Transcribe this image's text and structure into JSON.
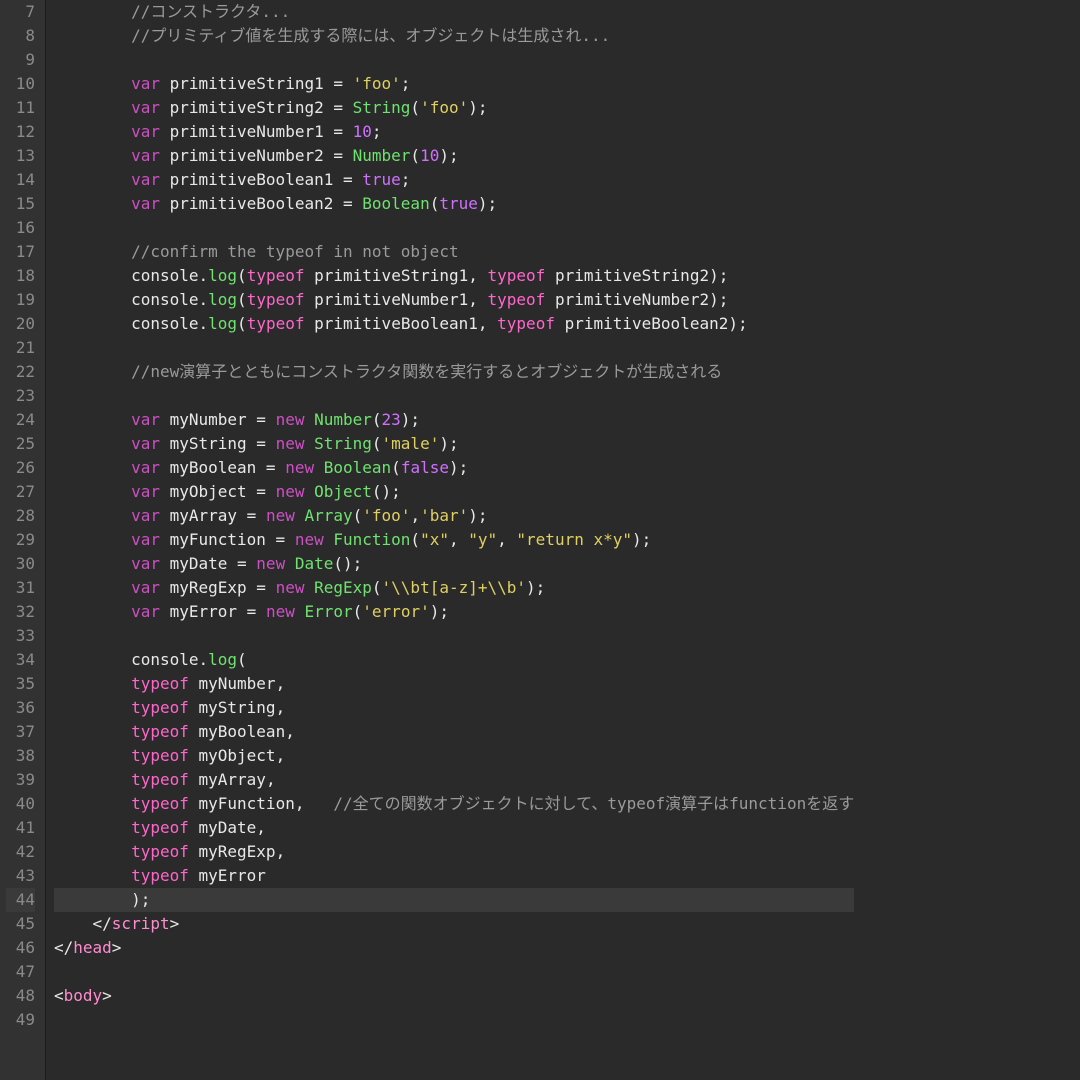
{
  "editor": {
    "first_line_number": 7,
    "current_line_number": 44,
    "lines": [
      {
        "tokens": [
          {
            "c": "c-com",
            "t": "        //コンストラクタ..."
          }
        ]
      },
      {
        "tokens": [
          {
            "c": "c-com",
            "t": "        //プリミティブ値を生成する際には、オブジェクトは生成され..."
          }
        ]
      },
      {
        "tokens": []
      },
      {
        "tokens": [
          {
            "c": "c-kw",
            "t": "        var "
          },
          {
            "c": "c-id",
            "t": "primitiveString1"
          },
          {
            "c": "c-pun",
            "t": " = "
          },
          {
            "c": "c-str",
            "t": "'foo'"
          },
          {
            "c": "c-pun",
            "t": ";"
          }
        ]
      },
      {
        "tokens": [
          {
            "c": "c-kw",
            "t": "        var "
          },
          {
            "c": "c-id",
            "t": "primitiveString2"
          },
          {
            "c": "c-pun",
            "t": " = "
          },
          {
            "c": "c-func",
            "t": "String"
          },
          {
            "c": "c-pun",
            "t": "("
          },
          {
            "c": "c-str",
            "t": "'foo'"
          },
          {
            "c": "c-pun",
            "t": ");"
          }
        ]
      },
      {
        "tokens": [
          {
            "c": "c-kw",
            "t": "        var "
          },
          {
            "c": "c-id",
            "t": "primitiveNumber1"
          },
          {
            "c": "c-pun",
            "t": " = "
          },
          {
            "c": "c-num",
            "t": "10"
          },
          {
            "c": "c-pun",
            "t": ";"
          }
        ]
      },
      {
        "tokens": [
          {
            "c": "c-kw",
            "t": "        var "
          },
          {
            "c": "c-id",
            "t": "primitiveNumber2"
          },
          {
            "c": "c-pun",
            "t": " = "
          },
          {
            "c": "c-func",
            "t": "Number"
          },
          {
            "c": "c-pun",
            "t": "("
          },
          {
            "c": "c-num",
            "t": "10"
          },
          {
            "c": "c-pun",
            "t": ");"
          }
        ]
      },
      {
        "tokens": [
          {
            "c": "c-kw",
            "t": "        var "
          },
          {
            "c": "c-id",
            "t": "primitiveBoolean1"
          },
          {
            "c": "c-pun",
            "t": " = "
          },
          {
            "c": "c-bool",
            "t": "true"
          },
          {
            "c": "c-pun",
            "t": ";"
          }
        ]
      },
      {
        "tokens": [
          {
            "c": "c-kw",
            "t": "        var "
          },
          {
            "c": "c-id",
            "t": "primitiveBoolean2"
          },
          {
            "c": "c-pun",
            "t": " = "
          },
          {
            "c": "c-func",
            "t": "Boolean"
          },
          {
            "c": "c-pun",
            "t": "("
          },
          {
            "c": "c-bool",
            "t": "true"
          },
          {
            "c": "c-pun",
            "t": ");"
          }
        ]
      },
      {
        "tokens": []
      },
      {
        "tokens": [
          {
            "c": "c-com",
            "t": "        //confirm the typeof in not object"
          }
        ]
      },
      {
        "tokens": [
          {
            "c": "c-id",
            "t": "        console"
          },
          {
            "c": "c-pun",
            "t": "."
          },
          {
            "c": "c-func",
            "t": "log"
          },
          {
            "c": "c-pun",
            "t": "("
          },
          {
            "c": "c-op",
            "t": "typeof "
          },
          {
            "c": "c-id",
            "t": "primitiveString1"
          },
          {
            "c": "c-pun",
            "t": ", "
          },
          {
            "c": "c-op",
            "t": "typeof "
          },
          {
            "c": "c-id",
            "t": "primitiveString2"
          },
          {
            "c": "c-pun",
            "t": ");"
          }
        ]
      },
      {
        "tokens": [
          {
            "c": "c-id",
            "t": "        console"
          },
          {
            "c": "c-pun",
            "t": "."
          },
          {
            "c": "c-func",
            "t": "log"
          },
          {
            "c": "c-pun",
            "t": "("
          },
          {
            "c": "c-op",
            "t": "typeof "
          },
          {
            "c": "c-id",
            "t": "primitiveNumber1"
          },
          {
            "c": "c-pun",
            "t": ", "
          },
          {
            "c": "c-op",
            "t": "typeof "
          },
          {
            "c": "c-id",
            "t": "primitiveNumber2"
          },
          {
            "c": "c-pun",
            "t": ");"
          }
        ]
      },
      {
        "tokens": [
          {
            "c": "c-id",
            "t": "        console"
          },
          {
            "c": "c-pun",
            "t": "."
          },
          {
            "c": "c-func",
            "t": "log"
          },
          {
            "c": "c-pun",
            "t": "("
          },
          {
            "c": "c-op",
            "t": "typeof "
          },
          {
            "c": "c-id",
            "t": "primitiveBoolean1"
          },
          {
            "c": "c-pun",
            "t": ", "
          },
          {
            "c": "c-op",
            "t": "typeof "
          },
          {
            "c": "c-id",
            "t": "primitiveBoolean2"
          },
          {
            "c": "c-pun",
            "t": ");"
          }
        ]
      },
      {
        "tokens": []
      },
      {
        "tokens": [
          {
            "c": "c-com",
            "t": "        //new演算子とともにコンストラクタ関数を実行するとオブジェクトが生成される"
          }
        ]
      },
      {
        "tokens": []
      },
      {
        "tokens": [
          {
            "c": "c-kw",
            "t": "        var "
          },
          {
            "c": "c-id",
            "t": "myNumber"
          },
          {
            "c": "c-pun",
            "t": " = "
          },
          {
            "c": "c-kw",
            "t": "new "
          },
          {
            "c": "c-func",
            "t": "Number"
          },
          {
            "c": "c-pun",
            "t": "("
          },
          {
            "c": "c-num",
            "t": "23"
          },
          {
            "c": "c-pun",
            "t": ");"
          }
        ]
      },
      {
        "tokens": [
          {
            "c": "c-kw",
            "t": "        var "
          },
          {
            "c": "c-id",
            "t": "myString"
          },
          {
            "c": "c-pun",
            "t": " = "
          },
          {
            "c": "c-kw",
            "t": "new "
          },
          {
            "c": "c-func",
            "t": "String"
          },
          {
            "c": "c-pun",
            "t": "("
          },
          {
            "c": "c-str",
            "t": "'male'"
          },
          {
            "c": "c-pun",
            "t": ");"
          }
        ]
      },
      {
        "tokens": [
          {
            "c": "c-kw",
            "t": "        var "
          },
          {
            "c": "c-id",
            "t": "myBoolean"
          },
          {
            "c": "c-pun",
            "t": " = "
          },
          {
            "c": "c-kw",
            "t": "new "
          },
          {
            "c": "c-func",
            "t": "Boolean"
          },
          {
            "c": "c-pun",
            "t": "("
          },
          {
            "c": "c-bool",
            "t": "false"
          },
          {
            "c": "c-pun",
            "t": ");"
          }
        ]
      },
      {
        "tokens": [
          {
            "c": "c-kw",
            "t": "        var "
          },
          {
            "c": "c-id",
            "t": "myObject"
          },
          {
            "c": "c-pun",
            "t": " = "
          },
          {
            "c": "c-kw",
            "t": "new "
          },
          {
            "c": "c-func",
            "t": "Object"
          },
          {
            "c": "c-pun",
            "t": "();"
          }
        ]
      },
      {
        "tokens": [
          {
            "c": "c-kw",
            "t": "        var "
          },
          {
            "c": "c-id",
            "t": "myArray"
          },
          {
            "c": "c-pun",
            "t": " = "
          },
          {
            "c": "c-kw",
            "t": "new "
          },
          {
            "c": "c-func",
            "t": "Array"
          },
          {
            "c": "c-pun",
            "t": "("
          },
          {
            "c": "c-str",
            "t": "'foo'"
          },
          {
            "c": "c-pun",
            "t": ","
          },
          {
            "c": "c-str",
            "t": "'bar'"
          },
          {
            "c": "c-pun",
            "t": ");"
          }
        ]
      },
      {
        "tokens": [
          {
            "c": "c-kw",
            "t": "        var "
          },
          {
            "c": "c-id",
            "t": "myFunction"
          },
          {
            "c": "c-pun",
            "t": " = "
          },
          {
            "c": "c-kw",
            "t": "new "
          },
          {
            "c": "c-func",
            "t": "Function"
          },
          {
            "c": "c-pun",
            "t": "("
          },
          {
            "c": "c-str",
            "t": "\"x\""
          },
          {
            "c": "c-pun",
            "t": ", "
          },
          {
            "c": "c-str",
            "t": "\"y\""
          },
          {
            "c": "c-pun",
            "t": ", "
          },
          {
            "c": "c-str",
            "t": "\"return x*y\""
          },
          {
            "c": "c-pun",
            "t": ");"
          }
        ]
      },
      {
        "tokens": [
          {
            "c": "c-kw",
            "t": "        var "
          },
          {
            "c": "c-id",
            "t": "myDate"
          },
          {
            "c": "c-pun",
            "t": " = "
          },
          {
            "c": "c-kw",
            "t": "new "
          },
          {
            "c": "c-func",
            "t": "Date"
          },
          {
            "c": "c-pun",
            "t": "();"
          }
        ]
      },
      {
        "tokens": [
          {
            "c": "c-kw",
            "t": "        var "
          },
          {
            "c": "c-id",
            "t": "myRegExp"
          },
          {
            "c": "c-pun",
            "t": " = "
          },
          {
            "c": "c-kw",
            "t": "new "
          },
          {
            "c": "c-func",
            "t": "RegExp"
          },
          {
            "c": "c-pun",
            "t": "("
          },
          {
            "c": "c-str",
            "t": "'\\\\bt[a-z]+\\\\b'"
          },
          {
            "c": "c-pun",
            "t": ");"
          }
        ]
      },
      {
        "tokens": [
          {
            "c": "c-kw",
            "t": "        var "
          },
          {
            "c": "c-id",
            "t": "myError"
          },
          {
            "c": "c-pun",
            "t": " = "
          },
          {
            "c": "c-kw",
            "t": "new "
          },
          {
            "c": "c-func",
            "t": "Error"
          },
          {
            "c": "c-pun",
            "t": "("
          },
          {
            "c": "c-str",
            "t": "'error'"
          },
          {
            "c": "c-pun",
            "t": ");"
          }
        ]
      },
      {
        "tokens": []
      },
      {
        "tokens": [
          {
            "c": "c-id",
            "t": "        console"
          },
          {
            "c": "c-pun",
            "t": "."
          },
          {
            "c": "c-func",
            "t": "log"
          },
          {
            "c": "c-pun",
            "t": "("
          }
        ]
      },
      {
        "tokens": [
          {
            "c": "c-op",
            "t": "        typeof "
          },
          {
            "c": "c-id",
            "t": "myNumber"
          },
          {
            "c": "c-pun",
            "t": ","
          }
        ]
      },
      {
        "tokens": [
          {
            "c": "c-op",
            "t": "        typeof "
          },
          {
            "c": "c-id",
            "t": "myString"
          },
          {
            "c": "c-pun",
            "t": ","
          }
        ]
      },
      {
        "tokens": [
          {
            "c": "c-op",
            "t": "        typeof "
          },
          {
            "c": "c-id",
            "t": "myBoolean"
          },
          {
            "c": "c-pun",
            "t": ","
          }
        ]
      },
      {
        "tokens": [
          {
            "c": "c-op",
            "t": "        typeof "
          },
          {
            "c": "c-id",
            "t": "myObject"
          },
          {
            "c": "c-pun",
            "t": ","
          }
        ]
      },
      {
        "tokens": [
          {
            "c": "c-op",
            "t": "        typeof "
          },
          {
            "c": "c-id",
            "t": "myArray"
          },
          {
            "c": "c-pun",
            "t": ","
          }
        ]
      },
      {
        "tokens": [
          {
            "c": "c-op",
            "t": "        typeof "
          },
          {
            "c": "c-id",
            "t": "myFunction"
          },
          {
            "c": "c-pun",
            "t": ",   "
          },
          {
            "c": "c-com",
            "t": "//全ての関数オブジェクトに対して、typeof演算子はfunctionを返す"
          }
        ]
      },
      {
        "tokens": [
          {
            "c": "c-op",
            "t": "        typeof "
          },
          {
            "c": "c-id",
            "t": "myDate"
          },
          {
            "c": "c-pun",
            "t": ","
          }
        ]
      },
      {
        "tokens": [
          {
            "c": "c-op",
            "t": "        typeof "
          },
          {
            "c": "c-id",
            "t": "myRegExp"
          },
          {
            "c": "c-pun",
            "t": ","
          }
        ]
      },
      {
        "tokens": [
          {
            "c": "c-op",
            "t": "        typeof "
          },
          {
            "c": "c-id",
            "t": "myError"
          }
        ]
      },
      {
        "tokens": [
          {
            "c": "c-pun",
            "t": "        );"
          }
        ]
      },
      {
        "tokens": [
          {
            "c": "tag-br",
            "t": "    </"
          },
          {
            "c": "tag-nm",
            "t": "script"
          },
          {
            "c": "tag-br",
            "t": ">"
          }
        ]
      },
      {
        "tokens": [
          {
            "c": "tag-br",
            "t": "</"
          },
          {
            "c": "tag-nm",
            "t": "head"
          },
          {
            "c": "tag-br",
            "t": ">"
          }
        ]
      },
      {
        "tokens": []
      },
      {
        "tokens": [
          {
            "c": "tag-br",
            "t": "<"
          },
          {
            "c": "tag-nm",
            "t": "body"
          },
          {
            "c": "tag-br",
            "t": ">"
          }
        ]
      },
      {
        "tokens": []
      }
    ]
  }
}
